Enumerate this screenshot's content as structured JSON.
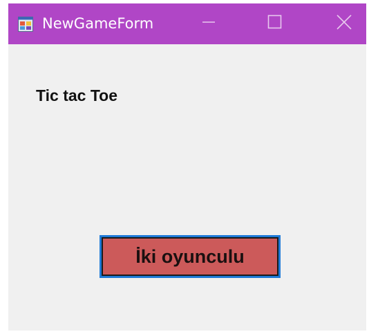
{
  "window": {
    "title": "NewGameForm",
    "titlebar_color": "#b046c6",
    "background_color": "#f0f0f0",
    "app_icon": "winforms-app-icon",
    "controls": {
      "minimize_icon": "minimize-icon",
      "maximize_icon": "maximize-icon",
      "close_icon": "close-icon"
    }
  },
  "form": {
    "heading": "Tic tac Toe",
    "start_button": {
      "label": "İki oyunculu",
      "background_color": "#cc5a5a",
      "focus_border_color": "#1e7ad8"
    }
  }
}
